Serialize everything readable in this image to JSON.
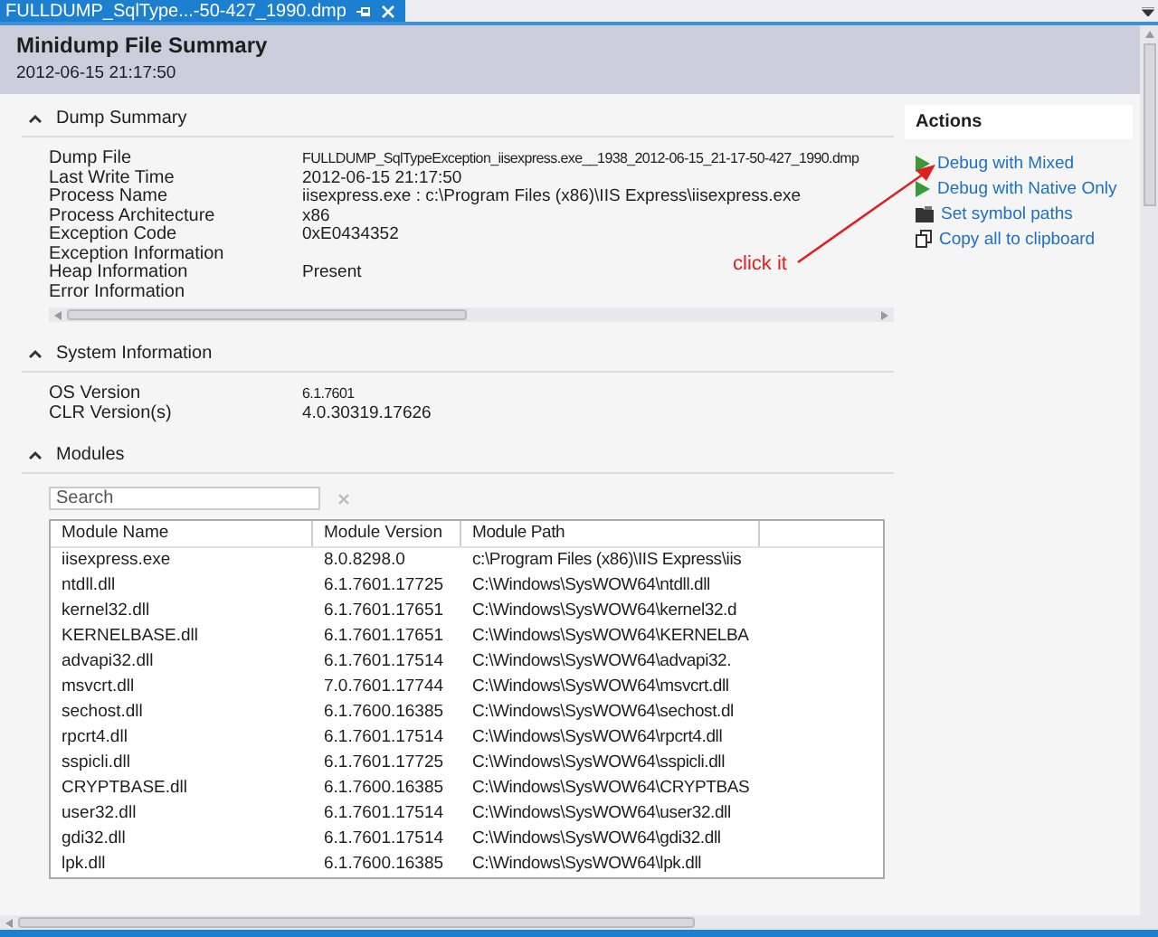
{
  "tab": {
    "title": "FULLDUMP_SqlType...-50-427_1990.dmp",
    "selected": true
  },
  "header": {
    "title": "Minidump File Summary",
    "timestamp": "2012-06-15 21:17:50"
  },
  "sections": [
    {
      "title": "Dump Summary",
      "expanded": true,
      "kind": "properties",
      "rows": [
        {
          "key": "Dump File",
          "value": "FULLDUMP_SqlTypeException_iisexpress.exe__1938_2012-06-15_21-17-50-427_1990.dmp"
        },
        {
          "key": "Last Write Time",
          "value": "2012-06-15 21:17:50"
        },
        {
          "key": "Process Name",
          "value": "iisexpress.exe : c:\\Program Files (x86)\\IIS Express\\iisexpress.exe"
        },
        {
          "key": "Process Architecture",
          "value": "x86"
        },
        {
          "key": "Exception Code",
          "value": "0xE0434352"
        },
        {
          "key": "Exception Information"
        },
        {
          "key": "Heap Information",
          "value": "Present"
        },
        {
          "key": "Error Information"
        }
      ],
      "scrollbar": true
    },
    {
      "title": "System Information",
      "expanded": true,
      "kind": "properties",
      "rows": [
        {
          "key": "OS Version",
          "value": "6.1.7601"
        },
        {
          "key": "CLR Version(s)",
          "value": "4.0.30319.17626"
        }
      ]
    },
    {
      "title": "Modules",
      "expanded": true,
      "kind": "table",
      "search": {
        "placeholder": "Search"
      },
      "columns": [
        "Module Name",
        "Module Version",
        "Module Path"
      ],
      "rows": [
        [
          "iisexpress.exe",
          "8.0.8298.0",
          "c:\\Program Files (x86)\\IIS Express\\iis"
        ],
        [
          "ntdll.dll",
          "6.1.7601.17725",
          "C:\\Windows\\SysWOW64\\ntdll.dll"
        ],
        [
          "kernel32.dll",
          "6.1.7601.17651",
          "C:\\Windows\\SysWOW64\\kernel32.d"
        ],
        [
          "KERNELBASE.dll",
          "6.1.7601.17651",
          "C:\\Windows\\SysWOW64\\KERNELBA"
        ],
        [
          "advapi32.dll",
          "6.1.7601.17514",
          "C:\\Windows\\SysWOW64\\advapi32."
        ],
        [
          "msvcrt.dll",
          "7.0.7601.17744",
          "C:\\Windows\\SysWOW64\\msvcrt.dll"
        ],
        [
          "sechost.dll",
          "6.1.7600.16385",
          "C:\\Windows\\SysWOW64\\sechost.dl"
        ],
        [
          "rpcrt4.dll",
          "6.1.7601.17514",
          "C:\\Windows\\SysWOW64\\rpcrt4.dll"
        ],
        [
          "sspicli.dll",
          "6.1.7601.17725",
          "C:\\Windows\\SysWOW64\\sspicli.dll"
        ],
        [
          "CRYPTBASE.dll",
          "6.1.7600.16385",
          "C:\\Windows\\SysWOW64\\CRYPTBAS"
        ],
        [
          "user32.dll",
          "6.1.7601.17514",
          "C:\\Windows\\SysWOW64\\user32.dll"
        ],
        [
          "gdi32.dll",
          "6.1.7601.17514",
          "C:\\Windows\\SysWOW64\\gdi32.dll"
        ],
        [
          "lpk.dll",
          "6.1.7600.16385",
          "C:\\Windows\\SysWOW64\\lpk.dll"
        ]
      ]
    }
  ],
  "actions": {
    "title": "Actions",
    "items": [
      {
        "kind": "run",
        "label": "Debug with Mixed"
      },
      {
        "kind": "run",
        "label": "Debug with Native Only"
      },
      {
        "kind": "symbols",
        "label": "Set symbol paths"
      },
      {
        "kind": "copy",
        "label": "Copy all to clipboard"
      }
    ]
  },
  "annotation": {
    "text": "click it"
  }
}
